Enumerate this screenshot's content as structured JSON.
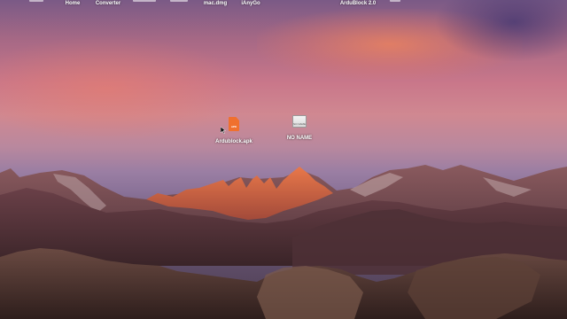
{
  "desktop": {
    "top_labels": [
      {
        "id": "home",
        "label": "Home"
      },
      {
        "id": "converter",
        "label": "Converter"
      },
      {
        "id": "mac-dmg",
        "label": "mac.dmg"
      },
      {
        "id": "ianygo",
        "label": "iAnyGo"
      },
      {
        "id": "ardublock2",
        "label": "ArduBlock 2.0"
      }
    ],
    "icons": [
      {
        "id": "ardublock-apk",
        "label": "Ardublock.apk",
        "icon": "apk-file-icon",
        "icon_text": "APK",
        "color": "#f0702e"
      },
      {
        "id": "no-name",
        "label": "NO NAME",
        "icon": "external-drive-icon",
        "icon_text": "NO NAME"
      }
    ],
    "wallpaper": "sierra-mountains"
  }
}
